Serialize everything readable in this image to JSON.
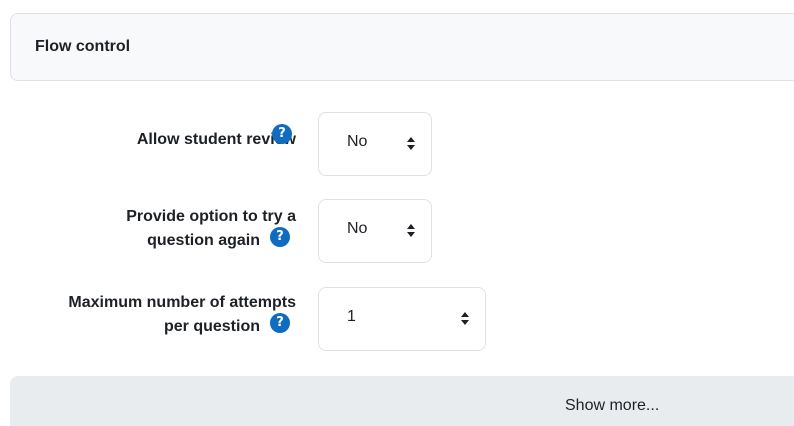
{
  "section": {
    "title": "Flow control"
  },
  "fields": [
    {
      "label_lines": [
        "Allow student review"
      ],
      "value": "No"
    },
    {
      "label_lines": [
        "Provide option to try a",
        "question again"
      ],
      "value": "No"
    },
    {
      "label_lines": [
        "Maximum number of attempts",
        "per question"
      ],
      "value": "1"
    }
  ],
  "help_icon_glyph": "?",
  "show_more": {
    "label": "Show more..."
  },
  "colors": {
    "accent": "#0f6cbf",
    "header_bg": "#f8f9fa",
    "show_more_bg": "#e9ecef",
    "border": "#dee2e6"
  }
}
